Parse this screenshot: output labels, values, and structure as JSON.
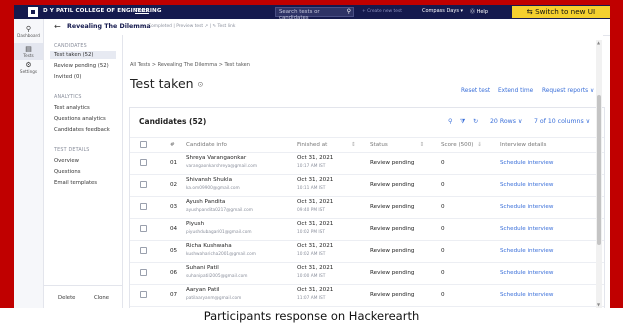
{
  "topbar": {
    "college": "D Y PATIL COLLEGE OF ENGINEERING",
    "tests_link": "Tests",
    "search_placeholder": "Search tests or candidates",
    "create_new_test": "+ Create new test",
    "compass": "Compass Days ▾",
    "help": "⓪ Help",
    "switch_label": "⇆ Switch to new UI",
    "bg_color": "#151a4e",
    "switch_color": "#f4d02e"
  },
  "navrail": {
    "items": [
      {
        "icon": "⚲",
        "icon_name": "dashboard-icon",
        "label": "Dashboard"
      },
      {
        "icon": "▤",
        "icon_name": "tests-icon",
        "label": "Tests"
      },
      {
        "icon": "⚙",
        "icon_name": "settings-icon",
        "label": "Settings"
      }
    ]
  },
  "header": {
    "back_icon": "←",
    "test_name": "Revealing The Dilemma",
    "meta": "Completed | Preview test ↗ | ✎ Test link"
  },
  "sidebar": {
    "candidates_title": "CANDIDATES",
    "candidates_items": [
      "Test taken (52)",
      "Review pending (52)",
      "Invited (0)"
    ],
    "analytics_title": "ANALYTICS",
    "analytics_items": [
      "Test analytics",
      "Questions analytics",
      "Candidates feedback"
    ],
    "details_title": "TEST DETAILS",
    "details_items": [
      "Overview",
      "Questions",
      "Email templates"
    ],
    "delete": "Delete",
    "clone": "Clone"
  },
  "main": {
    "crumbs": "All Tests > Revealing The Dilemma > Test taken",
    "title": "Test taken",
    "title_icon": "⊙",
    "reset": "Reset test",
    "extend": "Extend time",
    "request_reports": "Request reports ∨"
  },
  "table": {
    "title": "Candidates (52)",
    "tools": {
      "search_icon": "⚲",
      "filter_icon": "⧩",
      "refresh_icon": "↻",
      "rows": "20 Rows ∨",
      "columns": "7 of 10 columns ∨"
    },
    "headers": {
      "num": "#",
      "info": "Candidate info",
      "finished": "Finished at",
      "status": "Status",
      "score": "Score (500)",
      "interview": "Interview details",
      "extra": "A"
    },
    "rows": [
      {
        "num": "01",
        "name": "Shreya Varangaonkar",
        "email": "varangaonkarshreya@gmail.com",
        "date": "Oct 31, 2021",
        "time": "10:17 AM IST",
        "status": "Review pending",
        "score": "0",
        "interview": "Schedule interview"
      },
      {
        "num": "02",
        "name": "Shivansh Shukla",
        "email": "ka.om09900@gmail.com",
        "date": "Oct 31, 2021",
        "time": "10:11 AM IST",
        "status": "Review pending",
        "score": "0",
        "interview": "Schedule interview"
      },
      {
        "num": "03",
        "name": "Ayush Pandita",
        "email": "ayushpandita0217@gmail.com",
        "date": "Oct 31, 2021",
        "time": "09:40 PM IST",
        "status": "Review pending",
        "score": "0",
        "interview": "Schedule interview"
      },
      {
        "num": "04",
        "name": "Piyush",
        "email": "piyushdubagari01@gmail.com",
        "date": "Oct 31, 2021",
        "time": "10:02 PM IST",
        "status": "Review pending",
        "score": "0",
        "interview": "Schedule interview"
      },
      {
        "num": "05",
        "name": "Richa Kushwaha",
        "email": "kushwaharicha2001@gmail.com",
        "date": "Oct 31, 2021",
        "time": "10:02 AM IST",
        "status": "Review pending",
        "score": "0",
        "interview": "Schedule interview"
      },
      {
        "num": "06",
        "name": "Suhani Patil",
        "email": "suhanipatil2005@gmail.com",
        "date": "Oct 31, 2021",
        "time": "10:00 AM IST",
        "status": "Review pending",
        "score": "0",
        "interview": "Schedule interview"
      },
      {
        "num": "07",
        "name": "Aaryan Patil",
        "email": "patilaaryanm@gmail.com",
        "date": "Oct 31, 2021",
        "time": "11:07 AM IST",
        "status": "Review pending",
        "score": "0",
        "interview": "Schedule interview"
      }
    ]
  },
  "caption": "Participants response on Hackerearth",
  "colors": {
    "frame": "#c00000",
    "link": "#3a6fd9"
  }
}
